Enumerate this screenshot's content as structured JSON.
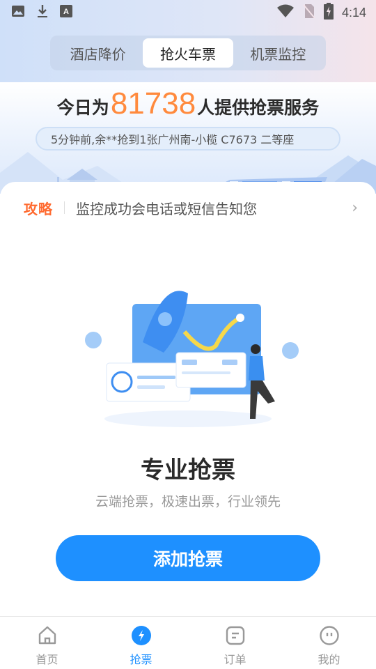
{
  "status_bar": {
    "time": "4:14",
    "left_icons": [
      "image-icon",
      "download-icon",
      "font-icon"
    ],
    "right_icons": [
      "wifi-icon",
      "no-sim-icon",
      "battery-charging-icon"
    ]
  },
  "segment_tabs": [
    {
      "label": "酒店降价",
      "active": false
    },
    {
      "label": "抢火车票",
      "active": true
    },
    {
      "label": "机票监控",
      "active": false
    }
  ],
  "banner": {
    "prefix": "今日为",
    "count": "81738",
    "suffix": "人提供抢票服务",
    "ticker": "5分钟前,余**抢到1张广州南-小榄 C7673 二等座",
    "accent_color": "#ff8a3d"
  },
  "tip": {
    "badge": "攻略",
    "text": "监控成功会电话或短信告知您",
    "chevron": ">"
  },
  "feature": {
    "title": "专业抢票",
    "subtitle": "云端抢票，极速出票，行业领先",
    "button_label": "添加抢票"
  },
  "tabbar": [
    {
      "label": "首页",
      "icon": "home-icon",
      "active": false
    },
    {
      "label": "抢票",
      "icon": "lightning-icon",
      "active": true
    },
    {
      "label": "订单",
      "icon": "order-icon",
      "active": false
    },
    {
      "label": "我的",
      "icon": "profile-icon",
      "active": false
    }
  ],
  "colors": {
    "primary": "#1e90ff",
    "orange": "#ff6a2f"
  }
}
